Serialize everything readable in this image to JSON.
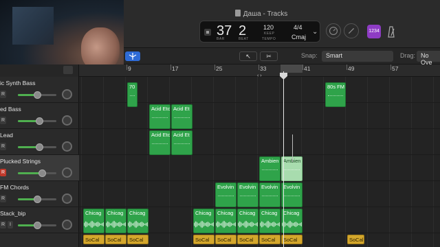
{
  "window": {
    "title": "Даша - Tracks"
  },
  "lcd": {
    "bar": "37",
    "bar_caption": "BAR",
    "beat": "2",
    "beat_caption": "BEAT",
    "tempo": "120",
    "tempo_mode": "KEEP",
    "tempo_caption": "TEMPO",
    "signature": "4/4",
    "key": "Cmaj"
  },
  "count_in": {
    "label": "1234"
  },
  "control_bar": {
    "snap_label": "Snap:",
    "snap_value": "Smart",
    "drag_label": "Drag:",
    "drag_value": "No Ove",
    "pointer_tool": "↖",
    "pointer_tool2": "✂"
  },
  "ruler": {
    "bars": [
      {
        "label": "9"
      },
      {
        "label": "17"
      },
      {
        "label": "25"
      },
      {
        "label": "33"
      },
      {
        "label": "41"
      },
      {
        "label": "49"
      },
      {
        "label": "57"
      }
    ]
  },
  "tracks": [
    {
      "name": "ic Synth Bass",
      "rec": "R",
      "fill": 0.5
    },
    {
      "name": "ed Bass",
      "rec": "R",
      "fill": 0.55
    },
    {
      "name": "Lead",
      "rec": "R",
      "fill": 0.55
    },
    {
      "name": "Plucked Strings",
      "rec": "R",
      "fill": 0.62,
      "armed": true,
      "selected": true
    },
    {
      "name": "FM Chords",
      "rec": "R",
      "fill": 0.5
    },
    {
      "name": "Stack_bip",
      "rec": "R",
      "input": "I",
      "fill": 0.5
    }
  ],
  "regions": {
    "lane1": [
      {
        "label": "70"
      },
      {
        "label": "80s FM"
      }
    ],
    "lane2": [
      {
        "label": "Acid Etc"
      },
      {
        "label": "Acid Et"
      }
    ],
    "lane3": [
      {
        "label": "Acid Etc"
      },
      {
        "label": "Acid Et"
      }
    ],
    "lane4": [
      {
        "label": "Ambien"
      },
      {
        "label": "Ambien"
      }
    ],
    "lane5": [
      {
        "label": "Evolvin"
      },
      {
        "label": "Evolvin"
      },
      {
        "label": "Evolvin"
      },
      {
        "label": "Evolvin"
      }
    ],
    "lane6": [
      {
        "label": "Chicag"
      },
      {
        "label": "Chicag"
      },
      {
        "label": "Chicag"
      },
      {
        "label": "Chicag"
      },
      {
        "label": "Chicag"
      },
      {
        "label": "Chicag"
      },
      {
        "label": "Chicag"
      },
      {
        "label": "Chicag"
      },
      {
        "label": "Chicag"
      }
    ],
    "lane7": [
      {
        "label": "SoCal"
      },
      {
        "label": "SoCal"
      },
      {
        "label": "SoCal"
      },
      {
        "label": "SoCal"
      },
      {
        "label": "SoCal"
      },
      {
        "label": "SoCal"
      },
      {
        "label": "SoCal"
      },
      {
        "label": "SoCal"
      },
      {
        "label": "SoCal"
      },
      {
        "label": "SoCal"
      }
    ]
  },
  "colors": {
    "midi_region": "#2fa34a",
    "audio_region": "#d4a72c",
    "count_in": "#8e3cc4",
    "catch": "#2e6bd6"
  }
}
